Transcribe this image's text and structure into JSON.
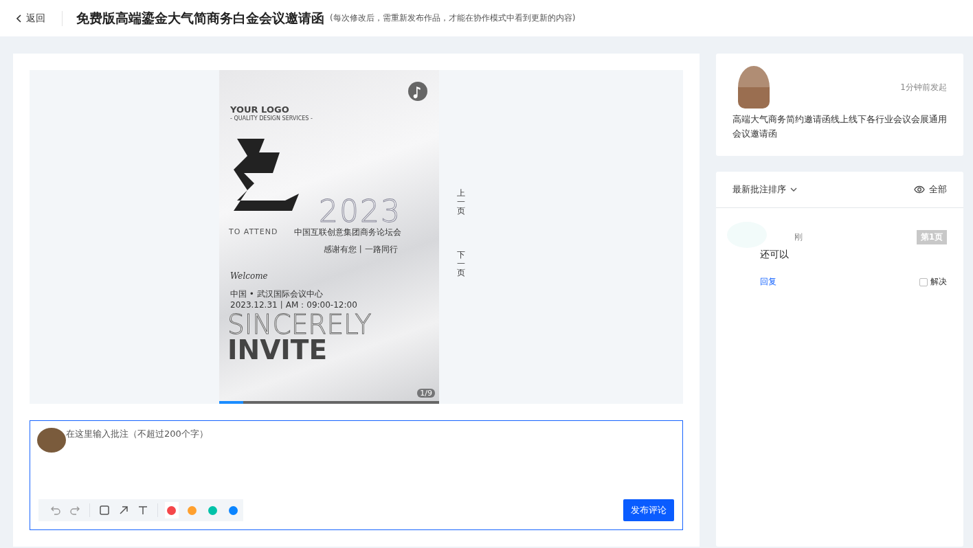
{
  "header": {
    "back": "返回",
    "title": "免费版高端鎏金大气简商务白金会议邀请函",
    "note": "(每次修改后，需重新发布作品，才能在协作模式中看到更新的内容)"
  },
  "poster": {
    "logo": "YOUR LOGO",
    "logo_sub": "- QUALITY DESIGN SERVICES -",
    "year": "2023",
    "to_attend": "TO ATTEND",
    "org": "中国互联创意集团商务论坛会",
    "slogan": "感谢有您丨一路同行",
    "welcome": "Welcome",
    "venue": "中国 • 武汉国际会议中心",
    "time": "2023.12.31丨AM：09:00-12:00",
    "line1": "SINCERELY",
    "line2": "INVITE",
    "page": "1/9",
    "level": 0.11
  },
  "page_nav": [
    {
      "label": "上一页"
    },
    {
      "label": "下一页"
    }
  ],
  "editor": {
    "placeholder": "在这里输入批注（不超过200个字）",
    "colors": [
      {
        "color": "#f5474a",
        "selected": true
      },
      {
        "color": "#ffa02e",
        "selected": false
      },
      {
        "color": "#00c2a8",
        "selected": false
      },
      {
        "color": "#0a84ff",
        "selected": false
      }
    ],
    "submit": "发布评论"
  },
  "info": {
    "time": "1分钟前发起",
    "description": "高端大气商务简约邀请函线上线下各行业会议会展通用会议邀请函"
  },
  "comments_panel": {
    "sort": "最新批注排序",
    "filter": "全部",
    "comments": [
      {
        "time": "刚",
        "page": "第1页",
        "text": "还可以",
        "reply": "回复",
        "resolve": "解决",
        "resolved": false
      }
    ]
  }
}
